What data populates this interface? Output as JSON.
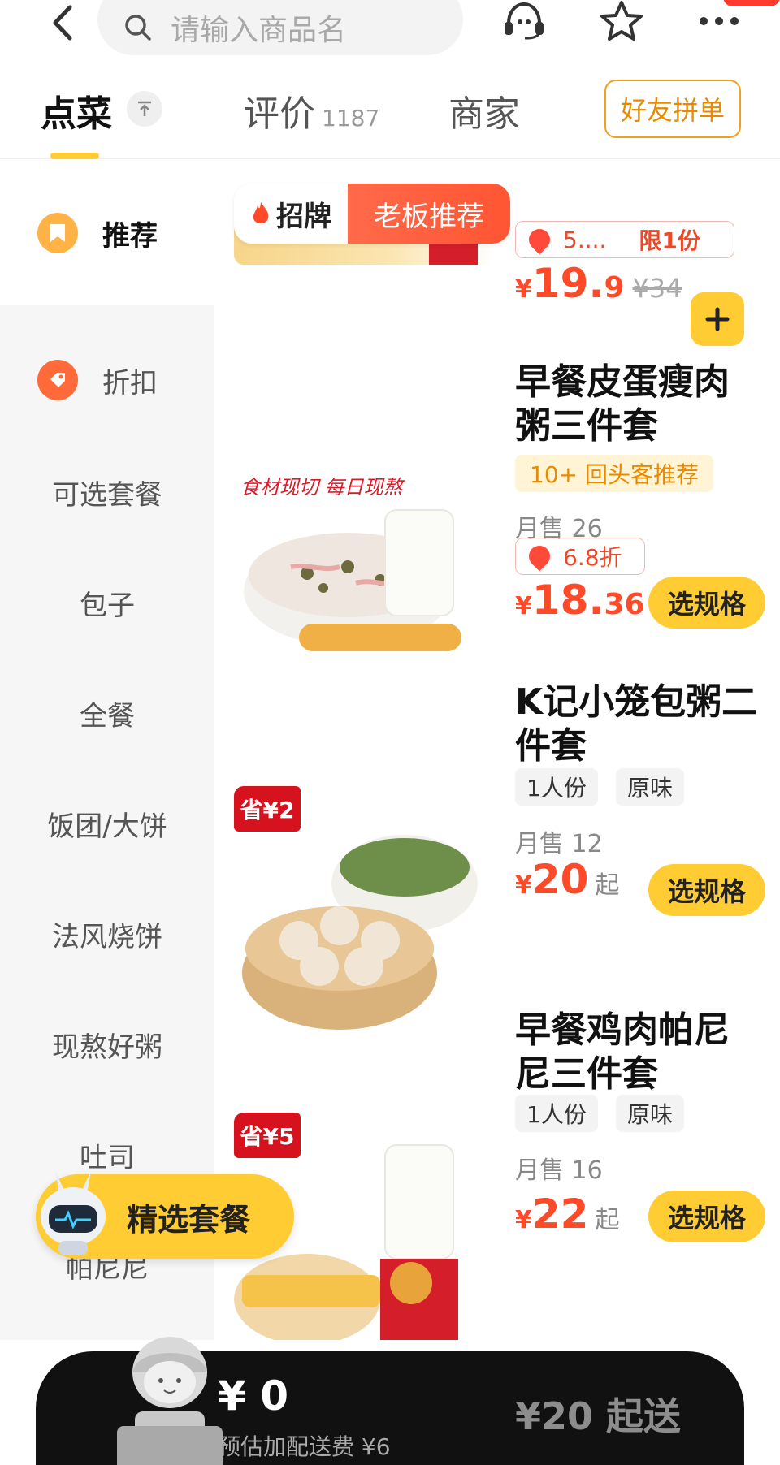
{
  "search": {
    "placeholder": "请输入商品名"
  },
  "tabs": [
    {
      "label": "点菜"
    },
    {
      "label": "评价",
      "count": "1187"
    },
    {
      "label": "商家"
    }
  ],
  "friend_order_button": "好友拼单",
  "sidebar": {
    "items": [
      {
        "label": "推荐"
      },
      {
        "label": "折扣"
      },
      {
        "label": "可选套餐"
      },
      {
        "label": "包子"
      },
      {
        "label": "全餐"
      },
      {
        "label": "饭团/大饼"
      },
      {
        "label": "法风烧饼"
      },
      {
        "label": "现熬好粥"
      },
      {
        "label": "吐司"
      },
      {
        "label": "帕尼尼"
      }
    ]
  },
  "banner": {
    "left": "招牌",
    "right": "老板推荐"
  },
  "products": [
    {
      "discount": "5....",
      "limit": "限1份",
      "price_currency": "¥",
      "price_int": "19.",
      "price_dec": "9",
      "old_price": "¥34"
    },
    {
      "title": "早餐皮蛋瘦肉粥三件套",
      "tag": "10+ 回头客推荐",
      "sales": "月售 26",
      "discount": "6.8折",
      "price_currency": "¥",
      "price_int": "18.",
      "price_dec": "36",
      "button": "选规格",
      "image_text": "食材现切 每日现熬"
    },
    {
      "title": "K记小笼包粥二件套",
      "save": "省¥2",
      "opt1": "1人份",
      "opt2": "原味",
      "sales": "月售 12",
      "price_currency": "¥",
      "price_int": "20",
      "price_suffix": "起",
      "button": "选规格"
    },
    {
      "title": "早餐鸡肉帕尼尼三件套",
      "save": "省¥5",
      "opt1": "1人份",
      "opt2": "原味",
      "sales": "月售 16",
      "price_currency": "¥",
      "price_int": "22",
      "price_suffix": "起",
      "button": "选规格"
    }
  ],
  "floating": {
    "label": "精选套餐"
  },
  "cart": {
    "total": "¥ 0",
    "fee": "预估加配送费 ¥6",
    "min_order": "¥20 起送"
  },
  "colors": {
    "accent": "#ffcc33",
    "price": "#ff4a2a",
    "bar": "#111111"
  }
}
